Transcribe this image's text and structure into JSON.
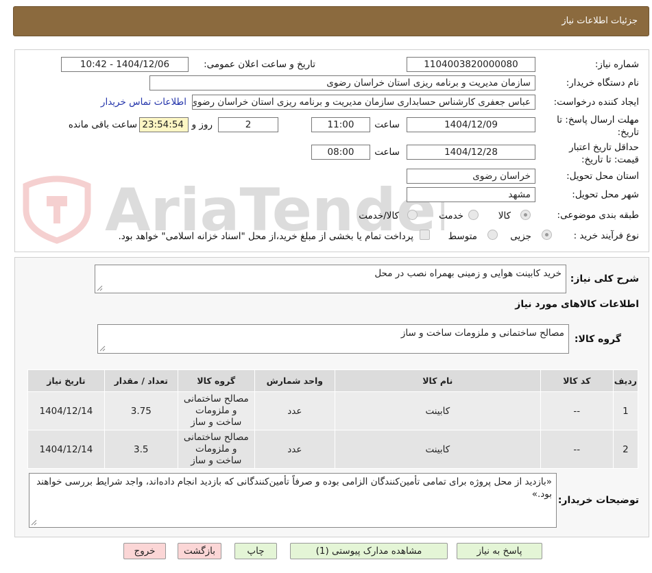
{
  "header": {
    "title": "جزئیات اطلاعات نیاز"
  },
  "form": {
    "need_number_label": "شماره نیاز:",
    "need_number": "1104003820000080",
    "announce_label": "تاریخ و ساعت اعلان عمومی:",
    "announce_value": "1404/12/06 - 10:42",
    "buyer_org_label": "نام دستگاه خریدار:",
    "buyer_org": "سازمان مدیریت و برنامه ریزی استان خراسان رضوی",
    "creator_label": "ایجاد کننده درخواست:",
    "creator": "عباس جعفری کارشناس حسابداری سازمان مدیریت و برنامه ریزی استان خراسان رضوی",
    "contact_link": "اطلاعات تماس خریدار",
    "deadline_label": "مهلت ارسال پاسخ: تا تاریخ:",
    "deadline_date": "1404/12/09",
    "hour_label": "ساعت",
    "deadline_time": "11:00",
    "days_value": "2",
    "days_label": "روز و",
    "remaining_time": "23:54:54",
    "remaining_label": "ساعت باقی مانده",
    "validity_label": "حداقل تاریخ اعتبار قیمت: تا تاریخ:",
    "validity_date": "1404/12/28",
    "validity_time": "08:00",
    "province_label": "استان محل تحویل:",
    "province": "خراسان رضوی",
    "city_label": "شهر محل تحویل:",
    "city": "مشهد",
    "category_label": "طبقه بندی موضوعی:",
    "category_options": [
      "کالا",
      "خدمت",
      "کالا/خدمت"
    ],
    "process_label": "نوع فرآیند خرید :",
    "process_options": [
      "جزیی",
      "متوسط"
    ],
    "payment_note": "پرداخت تمام یا بخشی از مبلغ خرید،از محل \"اسناد خزانه اسلامی\" خواهد بود."
  },
  "details": {
    "summary_label": "شرح کلی نیاز:",
    "summary": "خرید کابینت هوایی و زمینی بهمراه نصب در محل",
    "goods_title": "اطلاعات کالاهای مورد نیاز",
    "group_label": "گروه کالا:",
    "group_value": "مصالح ساختمانی و ملزومات ساخت و ساز",
    "columns": [
      "ردیف",
      "کد کالا",
      "نام کالا",
      "واحد شمارش",
      "گروه کالا",
      "تعداد / مقدار",
      "تاریخ نیاز"
    ],
    "rows": [
      {
        "idx": "1",
        "code": "--",
        "name": "کابینت",
        "unit": "عدد",
        "group": "مصالح ساختمانی و ملزومات ساخت و ساز",
        "qty": "3.75",
        "date": "1404/12/14"
      },
      {
        "idx": "2",
        "code": "--",
        "name": "کابینت",
        "unit": "عدد",
        "group": "مصالح ساختمانی و ملزومات ساخت و ساز",
        "qty": "3.5",
        "date": "1404/12/14"
      }
    ],
    "buyer_notes_label": "توضیحات خریدار:",
    "buyer_notes": "«بازدید از محل پروژه برای تمامی تأمین‌کنندگان الزامی بوده و صرفاً تأمین‌کنندگانی که بازدید انجام داده‌اند، واجد شرایط بررسی خواهند بود.»"
  },
  "buttons": {
    "reply": "پاسخ به نیاز",
    "attachments": "مشاهده مدارک پیوستی (1)",
    "print": "چاپ",
    "back": "بازگشت",
    "exit": "خروج"
  },
  "watermark": {
    "text": "AriaTender.neT"
  },
  "colors": {
    "header": "#8b6a3e",
    "button_green": "#e4f5d6",
    "button_pink": "#fbd6d6",
    "remaining_bg": "#fdf6c4",
    "link": "#2233aa"
  }
}
